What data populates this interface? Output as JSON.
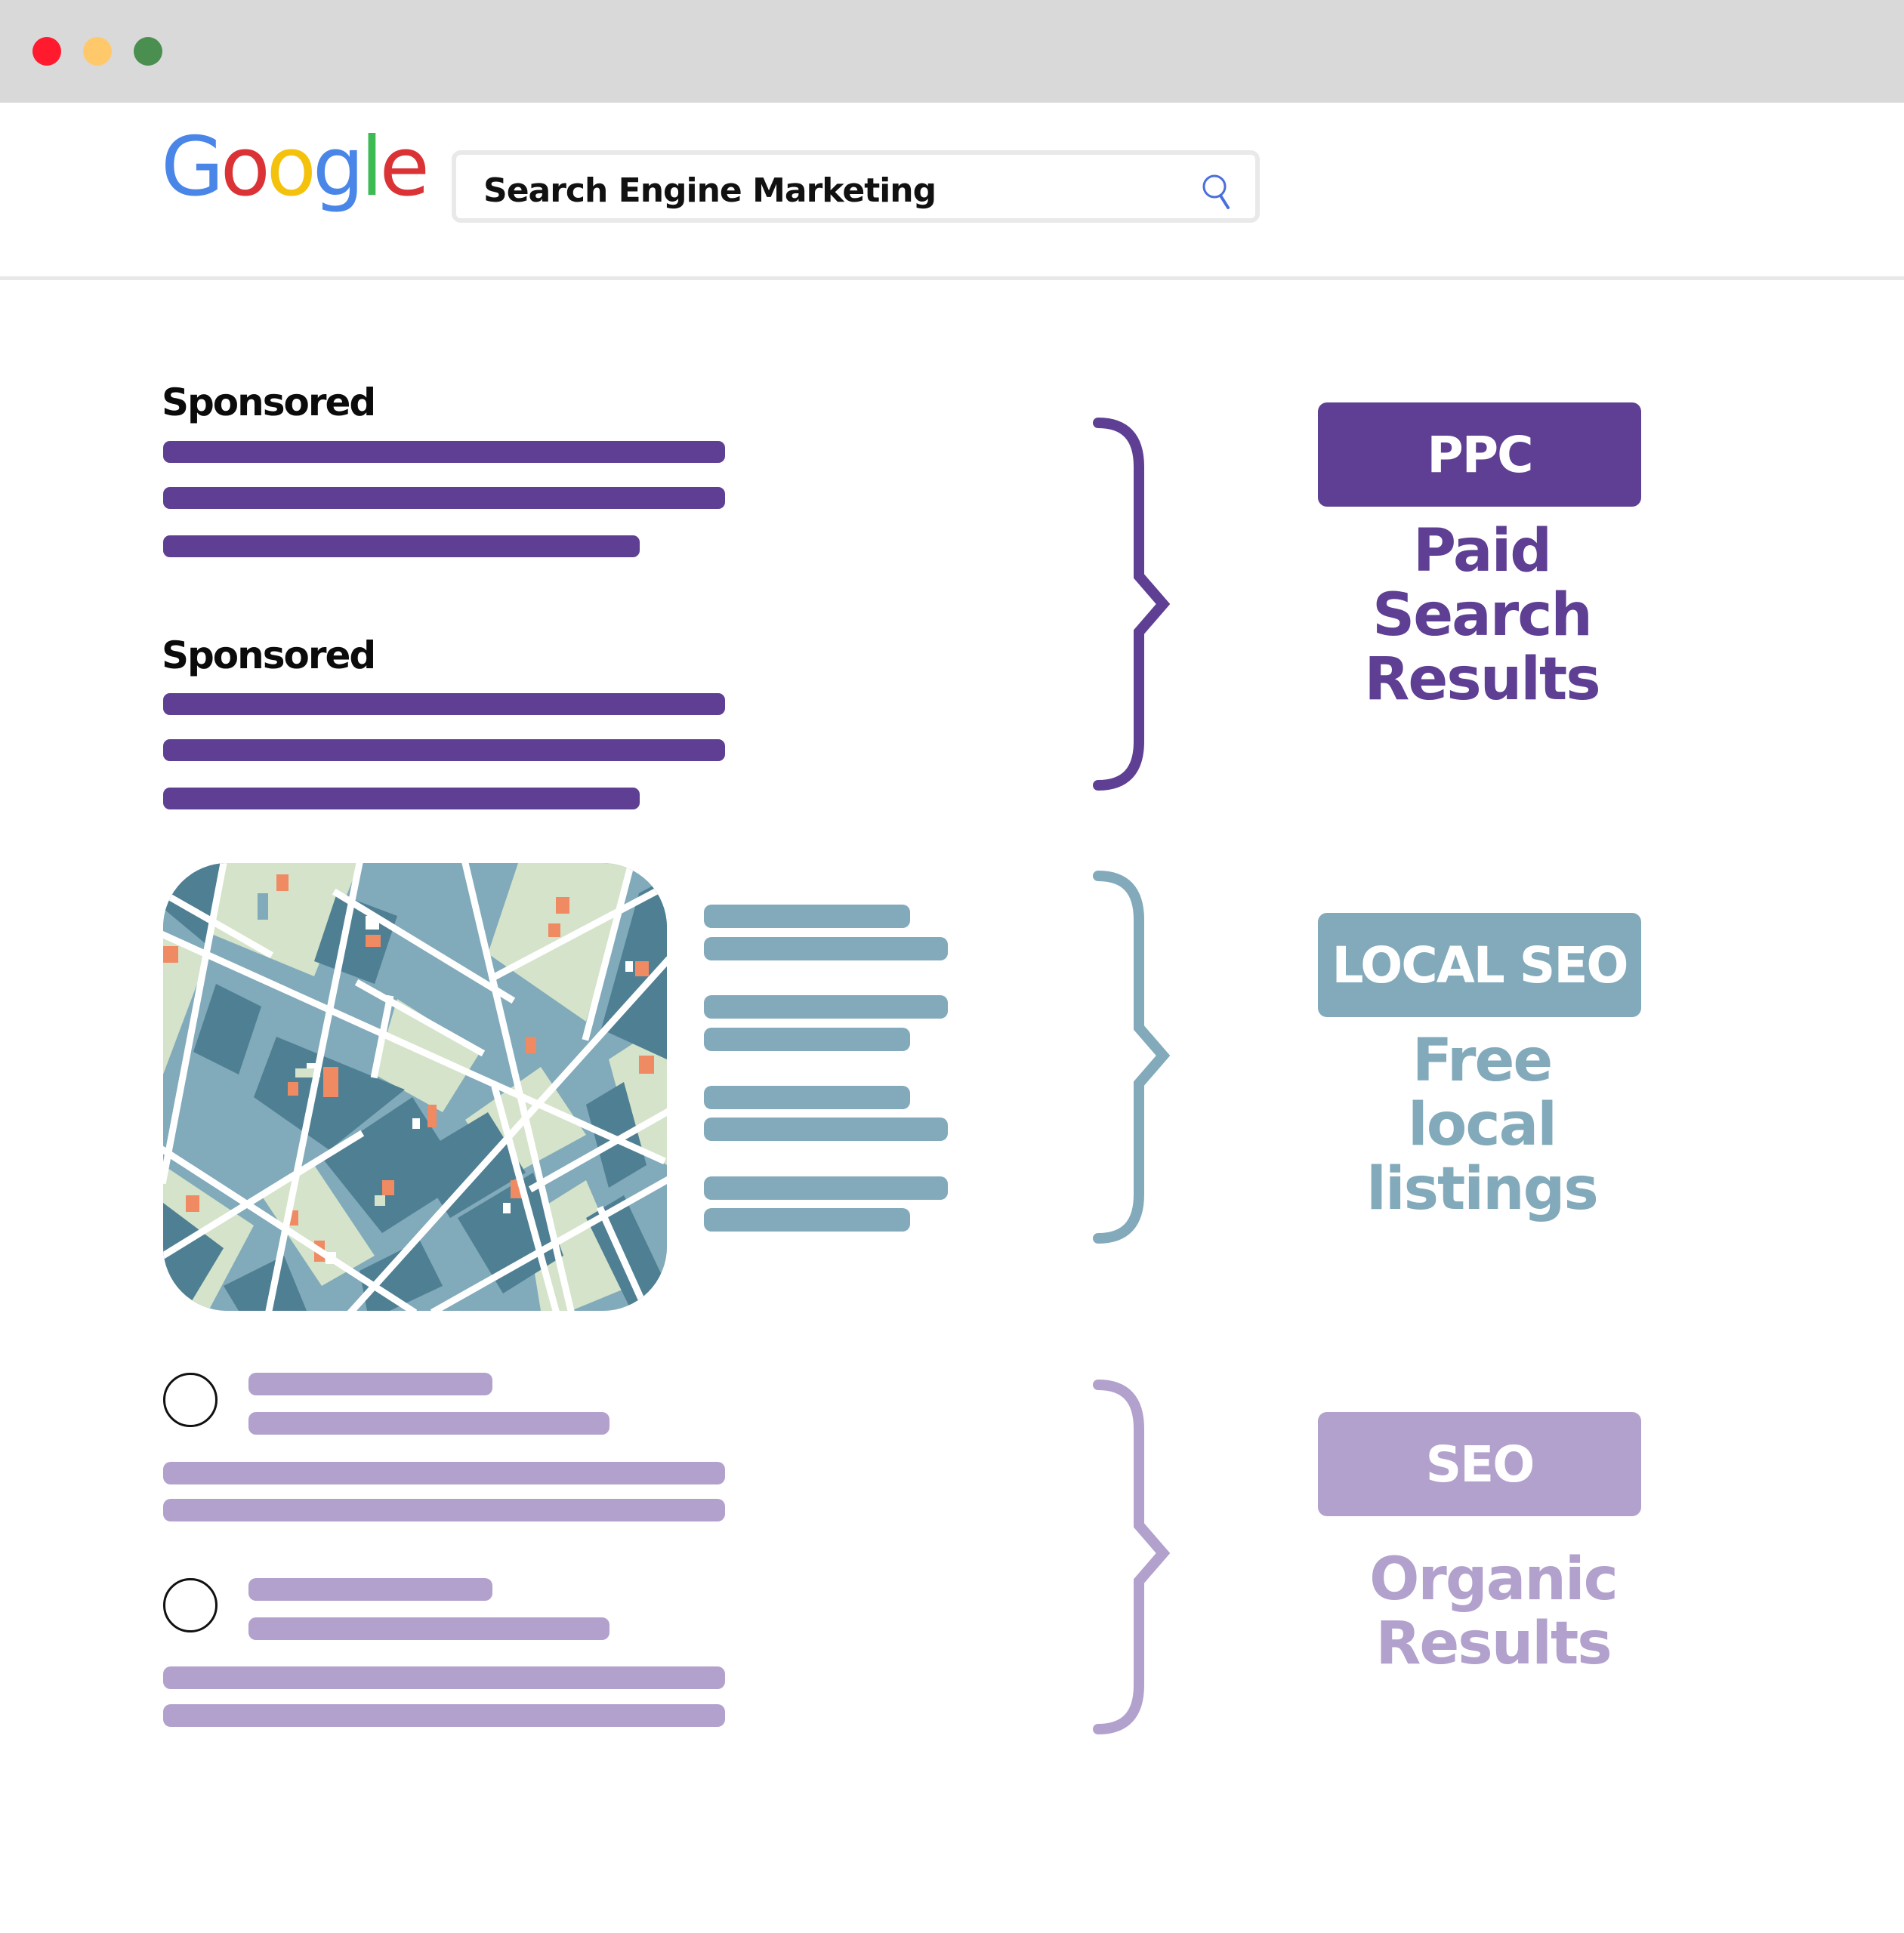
{
  "window": {
    "controls": [
      {
        "name": "close",
        "color": "#ff1a2e"
      },
      {
        "name": "minimize",
        "color": "#ffc96b"
      },
      {
        "name": "maximize",
        "color": "#4a8f4f"
      }
    ]
  },
  "header": {
    "logo": {
      "letters": [
        {
          "char": "G",
          "color": "#4a86e8"
        },
        {
          "char": "o",
          "color": "#db3236"
        },
        {
          "char": "o",
          "color": "#f4c20d"
        },
        {
          "char": "g",
          "color": "#4a86e8"
        },
        {
          "char": "l",
          "color": "#3cba54"
        },
        {
          "char": "e",
          "color": "#db3236"
        }
      ]
    },
    "search": {
      "query": "Search Engine Marketing",
      "icon": "search-icon",
      "icon_color": "#4a6fdc"
    }
  },
  "results": {
    "sponsored": [
      {
        "label": "Sponsored",
        "line_count": 3
      },
      {
        "label": "Sponsored",
        "line_count": 3
      }
    ],
    "local": {
      "map": "city-map-illustration",
      "listing_lines": 8
    },
    "organic": [
      {
        "favicon": "circle-outline",
        "title_lines": 2,
        "body_lines": 2
      },
      {
        "favicon": "circle-outline",
        "title_lines": 2,
        "body_lines": 2
      }
    ]
  },
  "annotations": [
    {
      "tag": "PPC",
      "description": [
        "Paid",
        "Search",
        "Results"
      ],
      "color": "#5e3f93"
    },
    {
      "tag": "LOCAL SEO",
      "description": [
        "Free",
        "local",
        "listings"
      ],
      "color": "#82aabb"
    },
    {
      "tag": "SEO",
      "description": [
        "Organic",
        "Results"
      ],
      "color": "#b1a1cc"
    }
  ],
  "colors": {
    "ppc": "#5e3f93",
    "local": "#82aabb",
    "organic": "#b1a1cc",
    "map_light_block": "#81aabb",
    "map_dark_block": "#4f7f93",
    "map_park": "#d4e3c9",
    "map_accent": "#f08a63"
  }
}
